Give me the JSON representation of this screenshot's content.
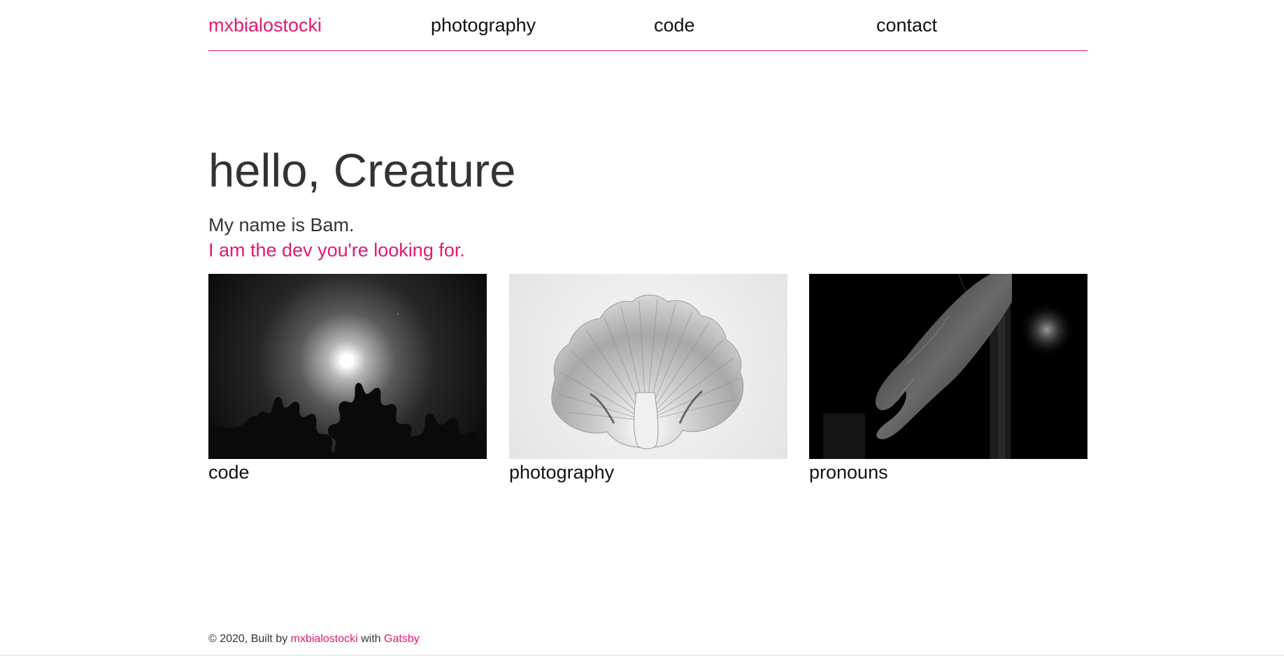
{
  "colors": {
    "accent": "#e5186f",
    "text": "#333333",
    "nav_text": "#111111",
    "background": "#ffffff"
  },
  "nav": {
    "brand": "mxbialostocki",
    "items": [
      "photography",
      "code",
      "contact"
    ]
  },
  "hero": {
    "title": "hello, Creature",
    "subtitle": "My name is Bam.",
    "tagline": "I am the dev you're looking for."
  },
  "cards": [
    {
      "label": "code",
      "image": "moon-over-trees-photo"
    },
    {
      "label": "photography",
      "image": "mushroom-gills-photo"
    },
    {
      "label": "pronouns",
      "image": "hand-in-shadow-photo"
    }
  ],
  "footer": {
    "prefix": "© 2020, Built by",
    "author_link": "mxbialostocki",
    "middle": "with",
    "framework_link": "Gatsby"
  }
}
